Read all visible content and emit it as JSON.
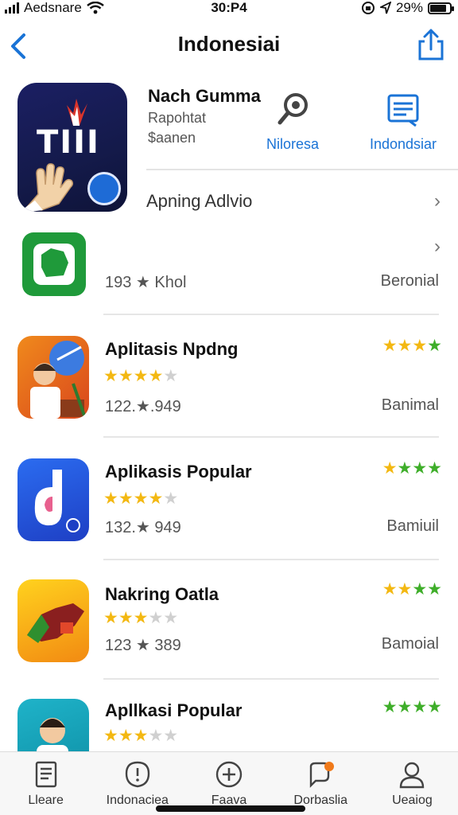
{
  "status": {
    "carrier": "Aedsnare",
    "time": "30:P4",
    "battery": "29%",
    "battery_level": 0.76
  },
  "nav": {
    "title": "Indonesiai"
  },
  "featured": {
    "icon_text": "TIII",
    "name": "Nach Gumma",
    "subtitle": "Rapohtat",
    "meta": "$aanen",
    "action1_label": "Niloresa",
    "action2_label": "Indondsiar",
    "row_label": "Apning Adlvio"
  },
  "items": [
    {
      "name": "",
      "stats": "193 ★ Khol",
      "badge": "Beronial",
      "stars": null,
      "right_stars": null
    },
    {
      "name": "Aplitasis Npdng",
      "stats": "122.★.949",
      "badge": "Banimal",
      "stars": 4,
      "right_stars": 4
    },
    {
      "name": "Aplikasis Popular",
      "stats": "132.★ 949",
      "badge": "Bamiuil",
      "stars": 4,
      "right_stars": 4
    },
    {
      "name": "Nakring Oatla",
      "stats": "123 ★ 389",
      "badge": "Bamoial",
      "stars": 3,
      "right_stars": 4
    },
    {
      "name": "Apllkasi Popular",
      "stats": "",
      "badge": "",
      "stars": 3,
      "right_stars": 4
    }
  ],
  "tabs": [
    {
      "label": "Lleare",
      "icon": "list-icon"
    },
    {
      "label": "Indonaciea",
      "icon": "alert-icon"
    },
    {
      "label": "Faava",
      "icon": "plus-icon"
    },
    {
      "label": "Dorbaslia",
      "icon": "chat-icon"
    },
    {
      "label": "Ueaiog",
      "icon": "user-icon"
    }
  ],
  "colors": {
    "accent": "#1a73d6",
    "star": "#f3b812",
    "green_star": "#3fae2a"
  }
}
